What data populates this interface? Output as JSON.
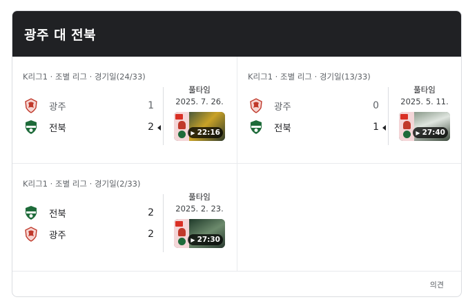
{
  "header": {
    "title": "광주 대 전북"
  },
  "matches": [
    {
      "league": "K리그1 · 조별 리그 · 경기일(24/33)",
      "teams": [
        {
          "name": "광주",
          "score": "1",
          "logo": "gwangju-fc-logo",
          "winner": false
        },
        {
          "name": "전북",
          "score": "2",
          "logo": "jeonbuk-logo",
          "winner": true
        }
      ],
      "status": "풀타임",
      "date": "2025. 7. 26.",
      "video_duration": "22:16"
    },
    {
      "league": "K리그1 · 조별 리그 · 경기일(13/33)",
      "teams": [
        {
          "name": "광주",
          "score": "0",
          "logo": "gwangju-fc-logo",
          "winner": false
        },
        {
          "name": "전북",
          "score": "1",
          "logo": "jeonbuk-logo",
          "winner": true
        }
      ],
      "status": "풀타임",
      "date": "2025. 5. 11.",
      "video_duration": "27:40"
    },
    {
      "league": "K리그1 · 조별 리그 · 경기일(2/33)",
      "teams": [
        {
          "name": "전북",
          "score": "2",
          "logo": "jeonbuk-logo",
          "winner": true
        },
        {
          "name": "광주",
          "score": "2",
          "logo": "gwangju-fc-logo",
          "winner": true
        }
      ],
      "status": "풀타임",
      "date": "2025. 2. 23.",
      "video_duration": "27:30"
    }
  ],
  "footer": {
    "feedback": "의견"
  },
  "colors": {
    "header_bg": "#202124",
    "gwangju_red": "#c0392b",
    "jeonbuk_green": "#1e6b3a"
  }
}
